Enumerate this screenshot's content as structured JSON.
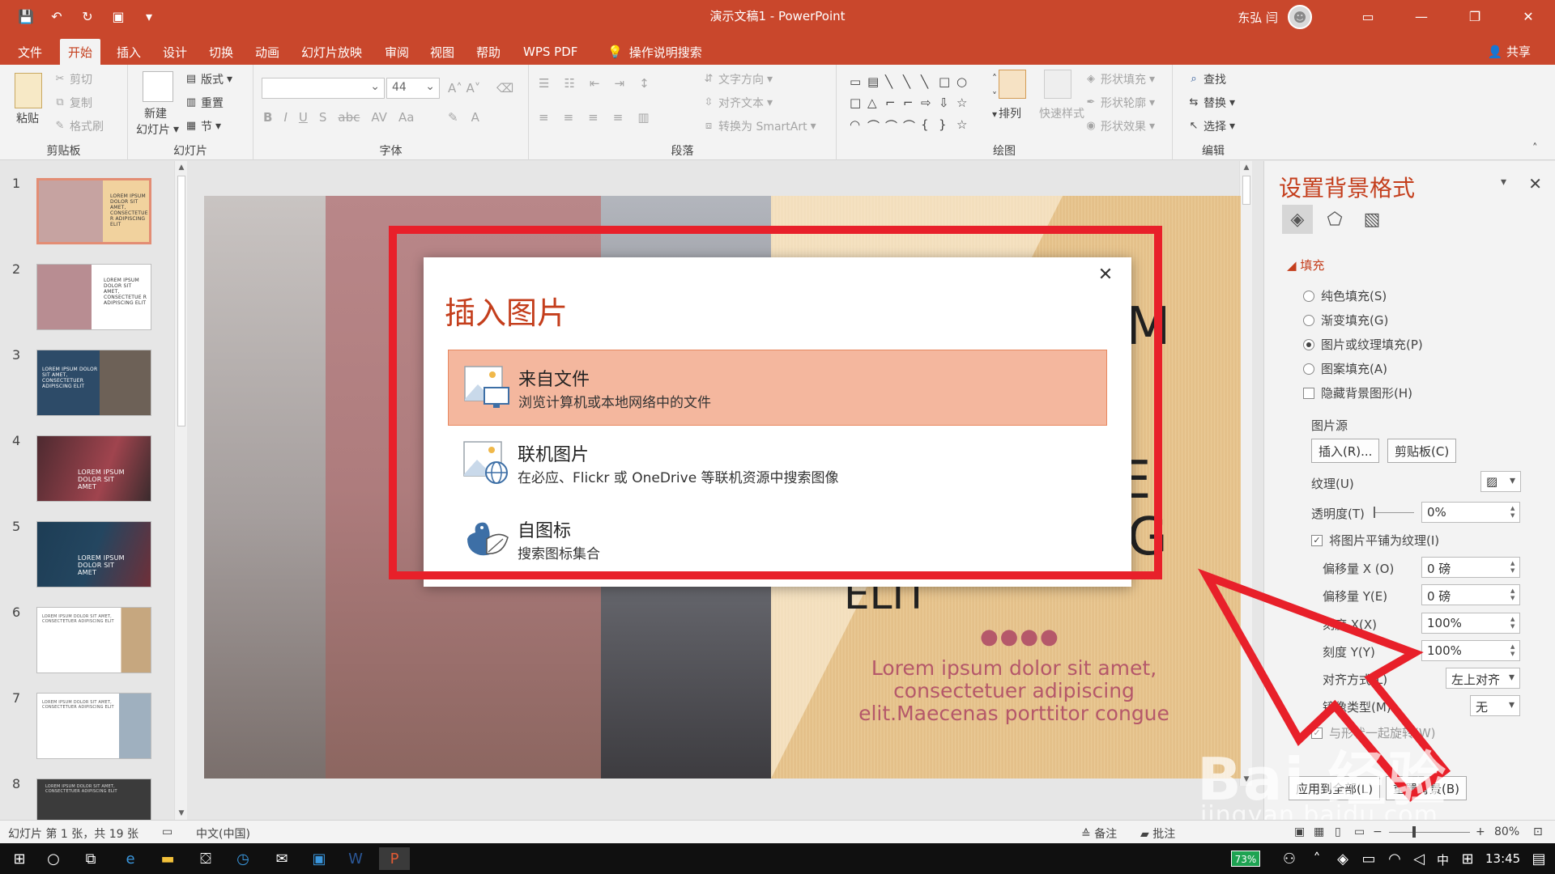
{
  "window": {
    "title": "演示文稿1  -  PowerPoint",
    "user_name": "东弘 闫",
    "share_label": "共享"
  },
  "ribbon_tabs": [
    "文件",
    "开始",
    "插入",
    "设计",
    "切换",
    "动画",
    "幻灯片放映",
    "审阅",
    "视图",
    "帮助",
    "WPS PDF",
    "操作说明搜索"
  ],
  "ribbon": {
    "clipboard": {
      "label": "剪贴板",
      "paste": "粘贴",
      "cut": "剪切",
      "copy": "复制",
      "format_painter": "格式刷"
    },
    "slides": {
      "label": "幻灯片",
      "new_slide": "新建",
      "new_slide_2": "幻灯片",
      "layout": "版式",
      "reset": "重置",
      "section": "节"
    },
    "font": {
      "label": "字体",
      "font_name": "",
      "font_size": "44"
    },
    "paragraph": {
      "label": "段落",
      "text_direction": "文字方向",
      "align_text": "对齐文本",
      "smartart": "转换为 SmartArt"
    },
    "drawing": {
      "label": "绘图",
      "arrange": "排列",
      "quick_styles": "快速样式",
      "shape_fill": "形状填充",
      "shape_outline": "形状轮廓",
      "shape_effects": "形状效果"
    },
    "editing": {
      "label": "编辑",
      "find": "查找",
      "replace": "替换",
      "select": "选择"
    }
  },
  "thumbnails": [
    {
      "num": "1",
      "text": "LOREM IPSUM DOLOR SIT AMET, CONSECTETUE R ADIPISCING ELIT"
    },
    {
      "num": "2",
      "text": "LOREM IPSUM DOLOR SIT AMET, CONSECTETUE R ADIPISCING ELIT"
    },
    {
      "num": "3",
      "text": "LOREM IPSUM DOLOR SIT AMET, CONSECTETUER ADIPISCING ELIT"
    },
    {
      "num": "4",
      "text": "LOREM IPSUM DOLOR SIT AMET"
    },
    {
      "num": "5",
      "text": "LOREM IPSUM DOLOR SIT AMET"
    },
    {
      "num": "6",
      "text": "LOREM IPSUM DOLOR SIT AMET, CONSECTETUER ADIPISCING ELIT"
    },
    {
      "num": "7",
      "text": "LOREM IPSUM DOLOR SIT AMET, CONSECTETUER ADIPISCING ELIT"
    },
    {
      "num": "8",
      "text": "LOREM IPSUM DOLOR SIT AMET, CONSECTETUER ADIPISCING ELIT"
    }
  ],
  "slide": {
    "big_text_1": "M",
    "big_text_2": "JE",
    "big_text_3": "G",
    "big_text_4": "ELIT",
    "dots": "●●●●",
    "subtitle": "Lorem ipsum dolor sit amet, consectetuer adipiscing elit.Maecenas porttitor congue"
  },
  "dialog": {
    "title": "插入图片",
    "options": [
      {
        "title": "来自文件",
        "desc": "浏览计算机或本地网络中的文件"
      },
      {
        "title": "联机图片",
        "desc": "在必应、Flickr 或 OneDrive 等联机资源中搜索图像"
      },
      {
        "title": "自图标",
        "desc": "搜索图标集合"
      }
    ]
  },
  "format_pane": {
    "title": "设置背景格式",
    "section": "填充",
    "fill_options": [
      "纯色填充(S)",
      "渐变填充(G)",
      "图片或纹理填充(P)",
      "图案填充(A)"
    ],
    "hide_bg": "隐藏背景图形(H)",
    "picture_source": "图片源",
    "insert_btn": "插入(R)...",
    "clipboard_btn": "剪贴板(C)",
    "texture": "纹理(U)",
    "transparency": "透明度(T)",
    "transparency_value": "0%",
    "tile_check": "将图片平铺为纹理(I)",
    "offset_x": "偏移量 X (O)",
    "offset_x_value": "0 磅",
    "offset_y": "偏移量 Y(E)",
    "offset_y_value": "0 磅",
    "scale_x": "刻度 X(X)",
    "scale_x_value": "100%",
    "scale_y": "刻度 Y(Y)",
    "scale_y_value": "100%",
    "align": "对齐方式(L)",
    "align_value": "左上对齐",
    "mirror": "镜像类型(M)",
    "mirror_value": "无",
    "rotate": "与形状一起旋转(W)",
    "apply_all": "应用到全部(L)",
    "reset_bg": "重置背景(B)"
  },
  "status": {
    "slide_info": "幻灯片 第 1 张，共 19 张",
    "language": "中文(中国)",
    "notes": "备注",
    "comments": "批注",
    "zoom": "80%"
  },
  "watermark": {
    "brand": "Bai 经验",
    "url": "jingyan.baidu.com"
  },
  "taskbar": {
    "battery": "73%",
    "ime": "中",
    "time": "13:45"
  }
}
